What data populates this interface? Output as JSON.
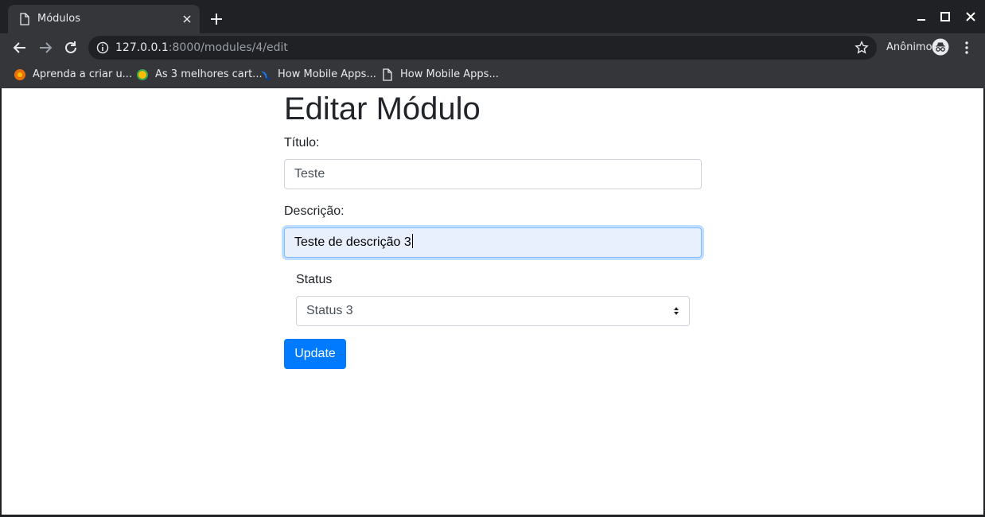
{
  "browser": {
    "tab": {
      "title": "Módulos",
      "icon": "page-icon"
    },
    "address": {
      "host": "127.0.0.1",
      "rest": ":8000/modules/4/edit"
    },
    "profile_label": "Anônimo",
    "bookmarks": [
      {
        "label": "Aprenda a criar u...",
        "icon": "favicon-orange"
      },
      {
        "label": "As 3 melhores cart...",
        "icon": "favicon-yellow"
      },
      {
        "label": "How Mobile Apps...",
        "icon": "favicon-blue-bird"
      },
      {
        "label": "How Mobile Apps...",
        "icon": "page-icon"
      }
    ]
  },
  "page": {
    "title": "Editar Módulo",
    "form": {
      "titulo_label": "Título:",
      "titulo_value": "Teste",
      "descricao_label": "Descrição:",
      "descricao_value": "Teste de descrição 3",
      "status_label": "Status",
      "status_value": "Status 3",
      "submit_label": "Update"
    }
  },
  "colors": {
    "primary": "#007bff",
    "chrome_dark": "#202124",
    "chrome_toolbar": "#35363a",
    "text": "#212529"
  }
}
